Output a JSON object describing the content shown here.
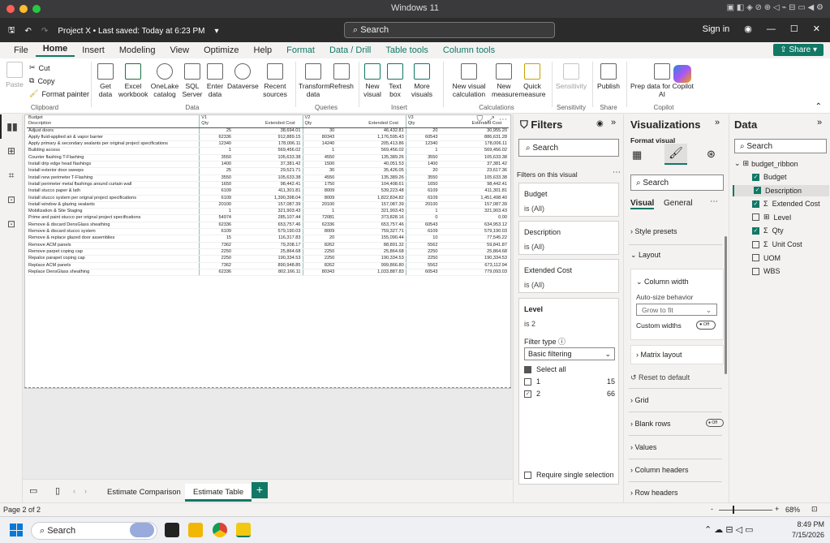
{
  "mac": {
    "title": "Windows 11"
  },
  "titlebar": {
    "project": "Project X • Last saved: Today at 6:23 PM",
    "search": "Search",
    "signin": "Sign in"
  },
  "menu": {
    "items": [
      "File",
      "Home",
      "Insert",
      "Modeling",
      "View",
      "Optimize",
      "Help",
      "Format",
      "Data / Drill",
      "Table tools",
      "Column tools"
    ],
    "share": "Share"
  },
  "ribbon": {
    "clipboard": {
      "paste": "Paste",
      "cut": "Cut",
      "copy": "Copy",
      "format_painter": "Format painter",
      "label": "Clipboard"
    },
    "data": {
      "get_data": "Get data",
      "excel": "Excel workbook",
      "onelake": "OneLake catalog",
      "sql": "SQL Server",
      "enter": "Enter data",
      "dataverse": "Dataverse",
      "recent": "Recent sources",
      "label": "Data"
    },
    "queries": {
      "transform": "Transform data",
      "refresh": "Refresh",
      "label": "Queries"
    },
    "insert": {
      "new_visual": "New visual",
      "text_box": "Text box",
      "more_visuals": "More visuals",
      "label": "Insert"
    },
    "calculations": {
      "new_visual_calc": "New visual calculation",
      "new_measure": "New measure",
      "quick_measure": "Quick measure",
      "label": "Calculations"
    },
    "sensitivity": {
      "btn": "Sensitivity",
      "label": "Sensitivity"
    },
    "share": {
      "publish": "Publish",
      "label": "Share"
    },
    "copilot": {
      "prep": "Prep data for Copilot AI",
      "label": "Copilot"
    }
  },
  "table": {
    "header1": [
      "Budget",
      "V1",
      "",
      "V2",
      "",
      "V3",
      ""
    ],
    "header2": [
      "Description",
      "Qty",
      "Extended Cost",
      "Qty",
      "Extended Cost",
      "Qty",
      "Extended Cost"
    ],
    "rows": [
      [
        "Adjust doors",
        "25",
        "38,694.01",
        "30",
        "46,432.81",
        "20",
        "30,955.20"
      ],
      [
        "Apply fluid-applied air & vapor barrier",
        "62336",
        "912,889.15",
        "80343",
        "1,176,595.43",
        "60543",
        "886,631.28"
      ],
      [
        "Apply primary & secondary sealants per original project specifications",
        "12340",
        "178,006.11",
        "14240",
        "205,413.86",
        "12340",
        "178,006.11"
      ],
      [
        "Building access",
        "1",
        "569,456.02",
        "1",
        "569,456.02",
        "1",
        "569,456.02"
      ],
      [
        "Counter flashing T-Flashing",
        "3550",
        "105,633.38",
        "4550",
        "135,389.26",
        "3550",
        "105,633.38"
      ],
      [
        "Install drip edge head flashings",
        "1400",
        "37,381.42",
        "1500",
        "40,051.53",
        "1400",
        "37,381.42"
      ],
      [
        "Install exterior door sweeps",
        "25",
        "29,521.71",
        "30",
        "35,426.05",
        "20",
        "23,617.36"
      ],
      [
        "Install new perimeter T-Flashing",
        "3550",
        "105,633.38",
        "4550",
        "135,389.26",
        "3550",
        "105,633.38"
      ],
      [
        "Install perimeter metal flashings around curtain wall",
        "1650",
        "98,442.41",
        "1750",
        "104,408.61",
        "1650",
        "98,442.41"
      ],
      [
        "Install stucco paper & lath",
        "6109",
        "411,301.81",
        "8009",
        "539,223.48",
        "6109",
        "411,301.81"
      ],
      [
        "Install stucco system per orignal project specifications",
        "6109",
        "1,390,398.04",
        "8009",
        "1,822,834.82",
        "6109",
        "1,451,498.40"
      ],
      [
        "Install window & glazing sealants",
        "20100",
        "157,087.39",
        "20100",
        "157,087.39",
        "20100",
        "157,087.39"
      ],
      [
        "Mobilization & Site Staging",
        "1",
        "321,903.43",
        "1",
        "321,903.43",
        "1",
        "321,903.43"
      ],
      [
        "Prime and paint stucco per orignal project specifications",
        "54974",
        "285,107.44",
        "72081",
        "373,828.16",
        "0",
        "0.00"
      ],
      [
        "Remove & discard DensGlass sheathing",
        "62336",
        "653,757.46",
        "62336",
        "653,757.46",
        "60543",
        "634,953.12"
      ],
      [
        "Remove & discard stucco system",
        "6109",
        "579,190.03",
        "8009",
        "759,327.71",
        "6109",
        "579,190.03"
      ],
      [
        "Remove & replace glazed door assemblies",
        "15",
        "116,317.83",
        "20",
        "155,090.44",
        "10",
        "77,545.22"
      ],
      [
        "Remove ACM panels",
        "7362",
        "79,208.17",
        "8262",
        "88,891.32",
        "5562",
        "59,841.87"
      ],
      [
        "Remove parpet coping cap",
        "2250",
        "25,864.68",
        "2250",
        "25,864.68",
        "2250",
        "25,864.68"
      ],
      [
        "Repalce parapet coping cap",
        "2250",
        "190,334.53",
        "2250",
        "190,334.53",
        "2250",
        "190,334.53"
      ],
      [
        "Replace ACM panels",
        "7362",
        "890,948.85",
        "8262",
        "999,866.80",
        "5562",
        "673,112.94"
      ],
      [
        "Replace DensGlass sheathing",
        "62336",
        "802,166.11",
        "80343",
        "1,033,887.83",
        "60543",
        "779,093.03"
      ]
    ]
  },
  "pages": {
    "tabs": [
      "Estimate Comparison",
      "Estimate Table"
    ]
  },
  "filters": {
    "title": "Filters",
    "search": "Search",
    "section": "Filters on this visual",
    "cards": [
      {
        "name": "Budget",
        "state": "is (All)"
      },
      {
        "name": "Description",
        "state": "is (All)"
      },
      {
        "name": "Extended Cost",
        "state": "is (All)"
      }
    ],
    "level": {
      "name": "Level",
      "state": "is 2",
      "filter_type_label": "Filter type",
      "filter_type": "Basic filtering",
      "select_all": "Select all",
      "options": [
        {
          "label": "1",
          "count": "15"
        },
        {
          "label": "2",
          "count": "66"
        }
      ]
    },
    "require_single": "Require single selection"
  },
  "viz": {
    "title": "Visualizations",
    "format_visual": "Format visual",
    "search": "Search",
    "tab_visual": "Visual",
    "tab_general": "General",
    "style_presets": "Style presets",
    "layout": "Layout",
    "column_width": "Column width",
    "auto_size": "Auto-size behavior",
    "auto_size_value": "Grow to fit",
    "custom_widths": "Custom widths",
    "toggle_off": "Off",
    "matrix_layout": "Matrix layout",
    "reset": "Reset to default",
    "grid": "Grid",
    "blank_rows": "Blank rows",
    "values": "Values",
    "column_headers": "Column headers",
    "row_headers": "Row headers"
  },
  "data": {
    "title": "Data",
    "search": "Search",
    "table": "budget_ribbon",
    "fields": [
      {
        "name": "Budget",
        "checked": true,
        "sigma": false
      },
      {
        "name": "Description",
        "checked": true,
        "sigma": false
      },
      {
        "name": "Extended Cost",
        "checked": true,
        "sigma": true
      },
      {
        "name": "Level",
        "checked": false,
        "sigma": false
      },
      {
        "name": "Qty",
        "checked": true,
        "sigma": true
      },
      {
        "name": "Unit Cost",
        "checked": false,
        "sigma": true
      },
      {
        "name": "UOM",
        "checked": false,
        "sigma": false
      },
      {
        "name": "WBS",
        "checked": false,
        "sigma": false
      }
    ]
  },
  "status": {
    "page": "Page 2 of 2",
    "zoom": "68%"
  },
  "taskbar": {
    "search": "Search",
    "time": "8:49 PM",
    "date": "7/15/2026"
  }
}
